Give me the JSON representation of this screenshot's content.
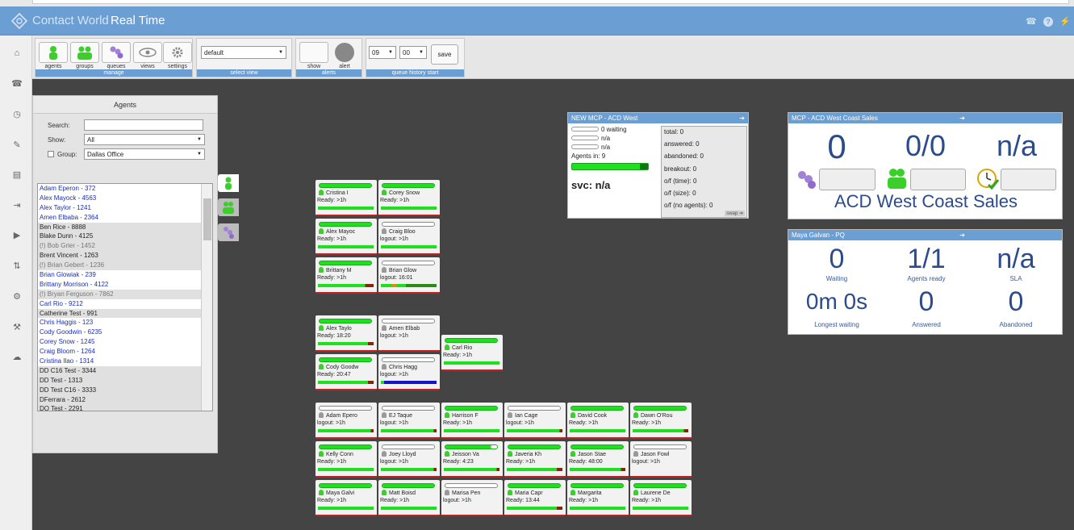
{
  "app": {
    "name": "Contact World",
    "page": "Real Time"
  },
  "toolbar": {
    "manage": {
      "caption": "manage",
      "buttons": [
        {
          "label": "agents",
          "icon": "agent-icon"
        },
        {
          "label": "groups",
          "icon": "group-icon"
        },
        {
          "label": "queues",
          "icon": "queue-icon"
        },
        {
          "label": "views",
          "icon": "eye-icon"
        },
        {
          "label": "settings",
          "icon": "gear-icon"
        }
      ]
    },
    "select_view": {
      "caption": "select view",
      "value": "default"
    },
    "alerts": {
      "caption": "alerts",
      "show_label": "show",
      "alert_label": "alert"
    },
    "queue_history": {
      "caption": "queue history start",
      "hour": "09",
      "minute": "00",
      "save_label": "save"
    }
  },
  "agents_panel": {
    "title": "Agents",
    "search_label": "Search:",
    "search_value": "",
    "show_label": "Show:",
    "show_value": "All",
    "group_label": "Group:",
    "group_value": "Dallas Office",
    "list": [
      {
        "text": "Adam Eperon - 372",
        "style": "blue"
      },
      {
        "text": "Alex Mayock - 4563",
        "style": "blue"
      },
      {
        "text": "Alex Taylor - 1241",
        "style": "blue"
      },
      {
        "text": "Amen Elbaba - 2364",
        "style": "blue"
      },
      {
        "text": "Ben Rice - 8888",
        "style": "black"
      },
      {
        "text": "Blake Dunn - 4125",
        "style": "black"
      },
      {
        "text": "(!) Bob Grier - 1452",
        "style": "dim"
      },
      {
        "text": "Brent Vincent - 1263",
        "style": "black"
      },
      {
        "text": "(!) Brian Gebert - 1236",
        "style": "dim"
      },
      {
        "text": "Brian Glowiak - 239",
        "style": "blue"
      },
      {
        "text": "Brittany Morrison - 4122",
        "style": "blue"
      },
      {
        "text": "(!) Bryan Ferguson - 7862",
        "style": "dim"
      },
      {
        "text": "Carl Rio - 9212",
        "style": "blue"
      },
      {
        "text": "Catherine Test - 991",
        "style": "black"
      },
      {
        "text": "Chris Haggis - 123",
        "style": "blue"
      },
      {
        "text": "Cody Goodwin - 6235",
        "style": "blue"
      },
      {
        "text": "Corey Snow - 1245",
        "style": "blue"
      },
      {
        "text": "Craig Bloom - 1264",
        "style": "blue"
      },
      {
        "text": "Cristina Ilao - 1314",
        "style": "blue"
      },
      {
        "text": "DD C16 Test - 3344",
        "style": "black"
      },
      {
        "text": "DD Test - 1313",
        "style": "black"
      },
      {
        "text": "DD Test C16 - 3333",
        "style": "black"
      },
      {
        "text": "DFerrara - 2612",
        "style": "black"
      },
      {
        "text": "DO Test - 2291",
        "style": "black"
      }
    ]
  },
  "agent_cards": [
    {
      "name": "Cristina I",
      "status": "Ready: >1h",
      "color": "green",
      "top": "green",
      "bottom": "green",
      "state_pct": 100
    },
    {
      "name": "Corey Snow",
      "status": "Ready: >1h",
      "color": "green",
      "top": "green",
      "bottom": "green",
      "state_pct": 100
    },
    {
      "name": "Alex Mayoc",
      "status": "Ready: >1h",
      "color": "green",
      "top": "green",
      "bottom": "green",
      "state_pct": 100
    },
    {
      "name": "Craig Bloo",
      "status": "logout: >1h",
      "color": "gray",
      "top": "empty",
      "bottom": "green",
      "state_pct": 100
    },
    {
      "name": "Brittany M",
      "status": "Ready: >1h",
      "color": "green",
      "top": "green",
      "bottom": "green",
      "state_pct": 85
    },
    {
      "name": "Brian Glow",
      "status": "logout: 16:01",
      "color": "gray",
      "top": "empty",
      "bottom": "mixed",
      "state_pct": 100
    },
    {
      "name": "Alex Taylo",
      "status": "Ready: 18:20",
      "color": "green",
      "top": "green",
      "bottom": "green",
      "state_pct": 90
    },
    {
      "name": "Amen Elbab",
      "status": "logout: >1h",
      "color": "gray",
      "top": "empty",
      "bottom": "none",
      "state_pct": 0
    },
    {
      "name": "Carl Rio",
      "status": "Ready: >1h",
      "color": "green",
      "top": "green",
      "bottom": "green",
      "state_pct": 100
    },
    {
      "name": "Cody Goodw",
      "status": "Ready: 20:47",
      "color": "green",
      "top": "green",
      "bottom": "green",
      "state_pct": 90
    },
    {
      "name": "Chris Hagg",
      "status": "logout: >1h",
      "color": "gray",
      "top": "empty",
      "bottom": "blue",
      "state_pct": 100
    },
    {
      "name": "Adam Epero",
      "status": "logout: >1h",
      "color": "gray",
      "top": "empty",
      "bottom": "green",
      "state_pct": 95
    },
    {
      "name": "EJ Taque",
      "status": "logout: >1h",
      "color": "gray",
      "top": "empty",
      "bottom": "green",
      "state_pct": 95
    },
    {
      "name": "Harrison F",
      "status": "Ready: >1h",
      "color": "green",
      "top": "green",
      "bottom": "green",
      "state_pct": 100
    },
    {
      "name": "Ian Cage",
      "status": "logout: >1h",
      "color": "gray",
      "top": "empty",
      "bottom": "green",
      "state_pct": 95
    },
    {
      "name": "David Cook",
      "status": "Ready: >1h",
      "color": "green",
      "top": "green",
      "bottom": "green",
      "state_pct": 100
    },
    {
      "name": "Dawn O'Rou",
      "status": "Ready: >1h",
      "color": "green",
      "top": "green",
      "bottom": "green",
      "state_pct": 92
    },
    {
      "name": "Kelly Conn",
      "status": "Ready: >1h",
      "color": "green",
      "top": "green",
      "bottom": "green",
      "state_pct": 100
    },
    {
      "name": "Joey Lloyd",
      "status": "logout: >1h",
      "color": "gray",
      "top": "empty",
      "bottom": "green",
      "state_pct": 95
    },
    {
      "name": "Jeisson Va",
      "status": "Ready: 4:23",
      "color": "green",
      "top": "partial",
      "bottom": "green",
      "state_pct": 95
    },
    {
      "name": "Javeria Kh",
      "status": "Ready: >1h",
      "color": "green",
      "top": "green",
      "bottom": "green",
      "state_pct": 90
    },
    {
      "name": "Jason Stae",
      "status": "Ready: 48:00",
      "color": "green",
      "top": "green",
      "bottom": "green",
      "state_pct": 92
    },
    {
      "name": "Jason Fowl",
      "status": "logout: >1h",
      "color": "gray",
      "top": "empty",
      "bottom": "none",
      "state_pct": 0
    },
    {
      "name": "Maya Galvi",
      "status": "Ready: >1h",
      "color": "green",
      "top": "green",
      "bottom": "green",
      "state_pct": 100
    },
    {
      "name": "Matt Boisd",
      "status": "Ready: >1h",
      "color": "green",
      "top": "green",
      "bottom": "green",
      "state_pct": 100
    },
    {
      "name": "Marisa Pen",
      "status": "logout: >1h",
      "color": "gray",
      "top": "empty",
      "bottom": "none",
      "state_pct": 0
    },
    {
      "name": "Maria Capr",
      "status": "Ready: 13:44",
      "color": "green",
      "top": "green",
      "bottom": "green",
      "state_pct": 90
    },
    {
      "name": "Margarita",
      "status": "Ready: >1h",
      "color": "green",
      "top": "green",
      "bottom": "green",
      "state_pct": 100
    },
    {
      "name": "Laurene De",
      "status": "Ready: >1h",
      "color": "green",
      "top": "green",
      "bottom": "green",
      "state_pct": 100
    }
  ],
  "queue_mcp": {
    "title": "NEW MCP - ACD West",
    "lines": [
      "0 waiting",
      "n/a",
      "n/a"
    ],
    "agents_in": "Agents in: 9",
    "svc": "svc: n/a",
    "stats": [
      "total: 0",
      "answered: 0",
      "abandoned: 0",
      "breakout: 0",
      "o/f (time): 0",
      "o/f (size): 0",
      "o/f (no agents): 0"
    ],
    "swap": "swap"
  },
  "group_card": {
    "title": "MCP - ACD West Coast Sales",
    "v1": "0",
    "v2": "0/0",
    "v3": "n/a",
    "name": "ACD West Coast Sales"
  },
  "pq_card": {
    "title": "Maya Galvan - PQ",
    "waiting": "0",
    "waiting_label": "Waiting",
    "ready": "1/1",
    "ready_label": "Agents ready",
    "sla": "n/a",
    "sla_label": "SLA",
    "longest": "0m 0s",
    "longest_label": "Longest waiting",
    "answered": "0",
    "answered_label": "Answered",
    "abandoned": "0",
    "abandoned_label": "Abandoned"
  }
}
